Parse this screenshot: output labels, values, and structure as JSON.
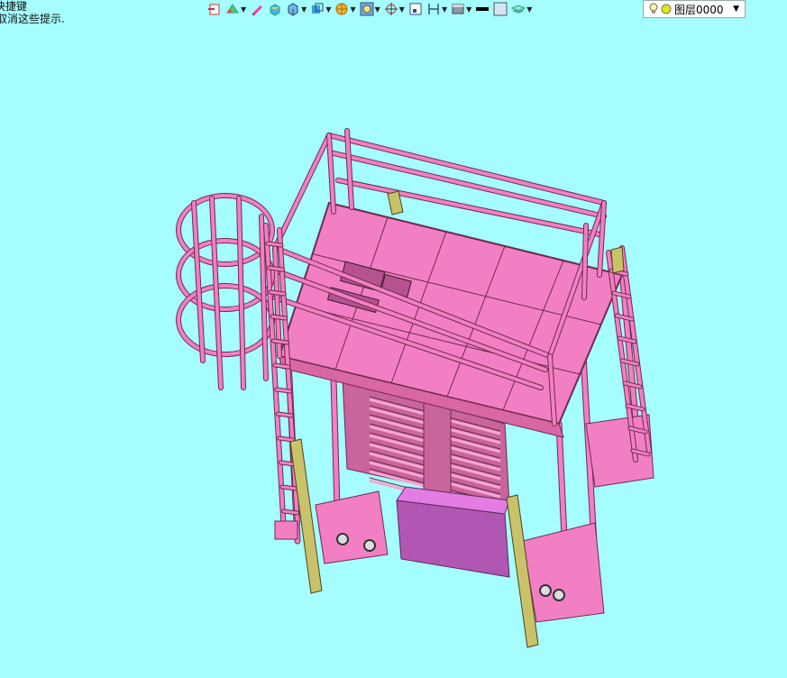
{
  "hint": {
    "line1": "快捷键",
    "line2": "取消这些提示."
  },
  "toolbar": {
    "tools": [
      {
        "name": "exit-sketch-icon",
        "dropdown": false
      },
      {
        "name": "surface-tool-icon",
        "dropdown": true
      },
      {
        "name": "pencil-icon",
        "dropdown": false
      },
      {
        "name": "shaded-box-icon",
        "dropdown": false
      },
      {
        "name": "cube-view-icon",
        "dropdown": true
      },
      {
        "name": "view-orient-icon",
        "dropdown": true
      },
      {
        "name": "render-style-icon",
        "dropdown": true
      },
      {
        "name": "zoom-ring-icon",
        "dropdown": true
      },
      {
        "name": "crosshair-icon",
        "dropdown": true
      },
      {
        "name": "fit-view-icon",
        "dropdown": false
      },
      {
        "name": "dimension-icon",
        "dropdown": true
      },
      {
        "name": "layer-display-icon",
        "dropdown": true
      },
      {
        "name": "line-weight-icon",
        "dropdown": false
      },
      {
        "name": "color-swatch-icon",
        "dropdown": false
      },
      {
        "name": "layers-stack-icon",
        "dropdown": true
      }
    ],
    "layer_select": {
      "value": "图层0000"
    }
  },
  "colors": {
    "background": "#a6fdfd",
    "structure": "#f27fc3",
    "structure_outline": "#6e2b4e",
    "posts": "#c9c26a",
    "tank": "#b156b2"
  }
}
